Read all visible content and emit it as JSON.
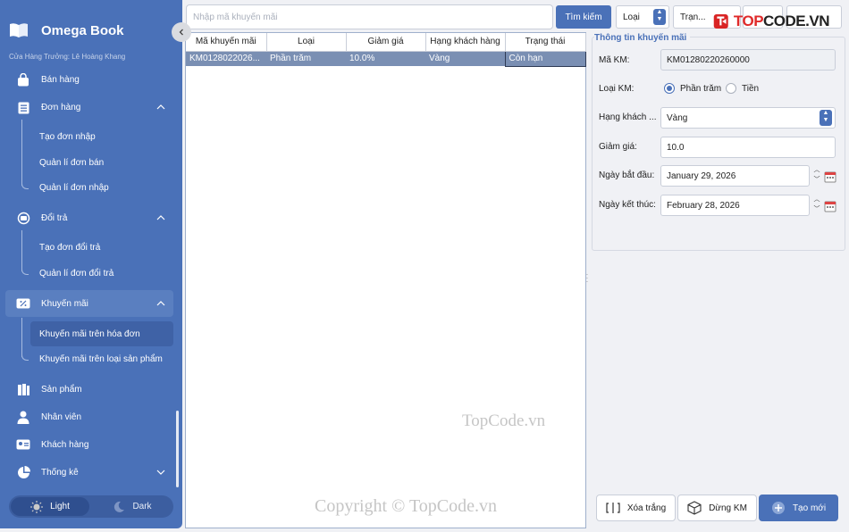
{
  "sidebar": {
    "app_name": "Omega Book",
    "store_text": "Cửa Hàng Trưởng: Lê Hoàng Khang",
    "items": {
      "sales": "Bán hàng",
      "orders": "Đơn hàng",
      "returns": "Đổi trả",
      "promotions": "Khuyến mãi",
      "products": "Sản phẩm",
      "staff": "Nhân viên",
      "customers": "Khách hàng",
      "stats": "Thống kê"
    },
    "sub": {
      "create_import": "Tạo đơn nhập",
      "manage_sales": "Quản lí đơn bán",
      "manage_import": "Quản lí đơn nhập",
      "create_return": "Tạo đơn đổi trả",
      "manage_return": "Quản lí đơn đổi trả",
      "promo_invoice": "Khuyến mãi trên hóa đơn",
      "promo_product": "Khuyến mãi trên loại sản phẩm"
    },
    "theme": {
      "light": "Light",
      "dark": "Dark"
    }
  },
  "toolbar": {
    "search_placeholder": "Nhập mã khuyến mãi",
    "search_button": "Tìm kiếm",
    "type_select": "Loại",
    "status_select": "Trạn..."
  },
  "table": {
    "columns": [
      "Mã khuyến mãi",
      "Loại",
      "Giảm giá",
      "Hạng khách hàng",
      "Trạng thái"
    ],
    "rows": [
      [
        "KM0128022026...",
        "Phần trăm",
        "10.0%",
        "Vàng",
        "Còn hạn"
      ]
    ]
  },
  "watermark": {
    "site": "TopCode.vn",
    "copyright": "Copyright © TopCode.vn"
  },
  "logo": {
    "prefix": "TOP",
    "suffix": "CODE.VN"
  },
  "form": {
    "title": "Thông tin khuyến mãi",
    "code_label": "Mã KM:",
    "code_value": "KM01280220260000",
    "type_label": "Loại KM:",
    "type_percent": "Phần trăm",
    "type_money": "Tiền",
    "rank_label": "Hạng khách ...",
    "rank_value": "Vàng",
    "discount_label": "Giảm giá:",
    "discount_value": "10.0",
    "start_label": "Ngày bắt đầu:",
    "start_value": "January 29, 2026",
    "end_label": "Ngày kết thúc:",
    "end_value": "February 28, 2026"
  },
  "actions": {
    "clear": "Xóa trắng",
    "stop": "Dừng KM",
    "create": "Tạo mới"
  },
  "colors": {
    "accent": "#4a71b8",
    "sidebar": "#4a71b8",
    "logo_red": "#e02a2a"
  }
}
